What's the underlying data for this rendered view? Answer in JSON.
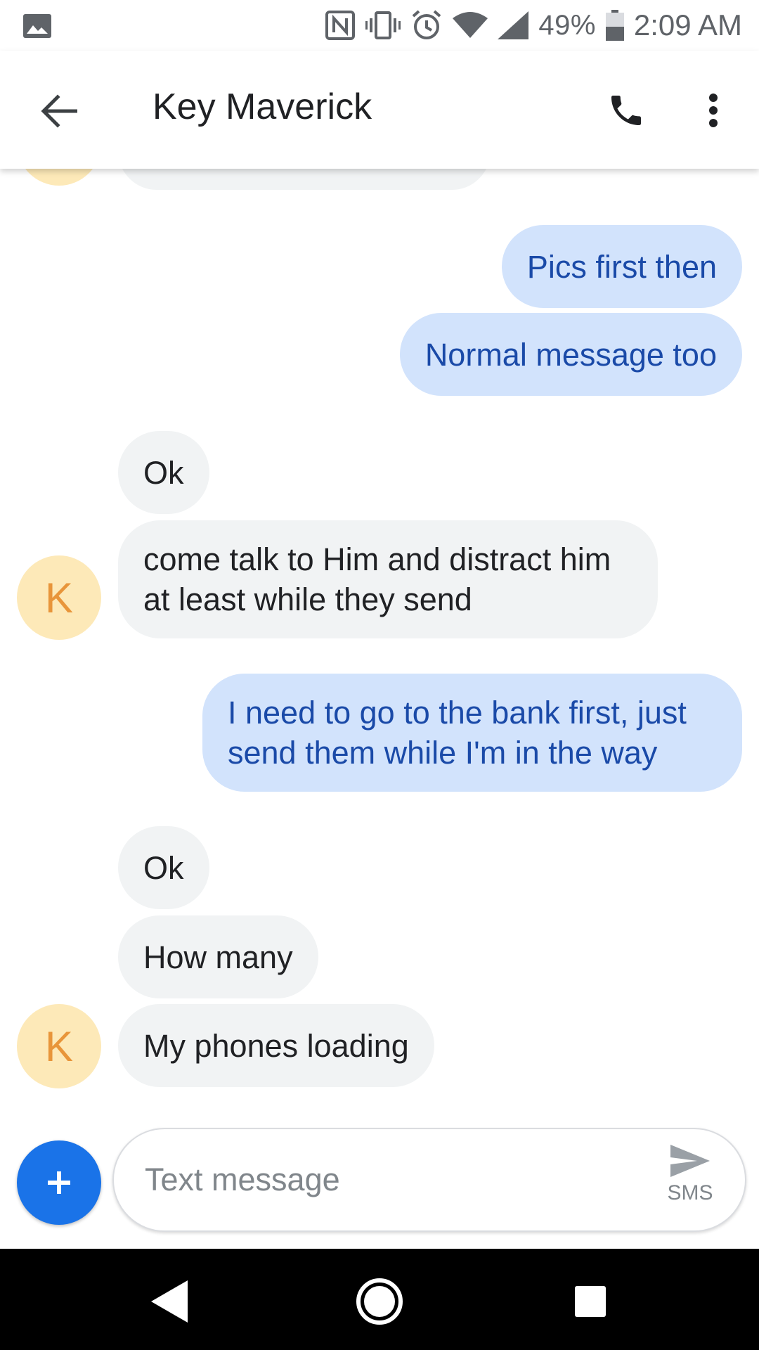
{
  "status_bar": {
    "battery": "49%",
    "time": "2:09 AM",
    "icons": [
      "image-icon",
      "nfc-icon",
      "vibrate-icon",
      "alarm-icon",
      "wifi-icon",
      "signal-icon",
      "battery-icon"
    ]
  },
  "app_bar": {
    "title": "Key Maverick",
    "icons": [
      "back-arrow-icon",
      "phone-icon",
      "more-vert-icon"
    ]
  },
  "avatar_initial": "K",
  "messages": [
    {
      "direction": "outgoing",
      "text": "Pics first then"
    },
    {
      "direction": "outgoing",
      "text": "Normal message too"
    },
    {
      "direction": "incoming",
      "text": "Ok"
    },
    {
      "direction": "incoming",
      "text": "come talk to Him and distract him at least while they send"
    },
    {
      "direction": "outgoing",
      "text": "I need to go to the bank first, just send them while I'm in the way"
    },
    {
      "direction": "incoming",
      "text": "Ok"
    },
    {
      "direction": "incoming",
      "text": "How many"
    },
    {
      "direction": "incoming",
      "text": "My phones loading"
    }
  ],
  "compose": {
    "placeholder": "Text message",
    "send_label": "SMS"
  },
  "colors": {
    "incoming_bubble": "#f1f3f4",
    "outgoing_bubble": "#d2e3fc",
    "outgoing_text": "#1a4aa8",
    "avatar_bg": "#fde9b8",
    "avatar_text": "#e8953a",
    "fab": "#1a73e8"
  }
}
